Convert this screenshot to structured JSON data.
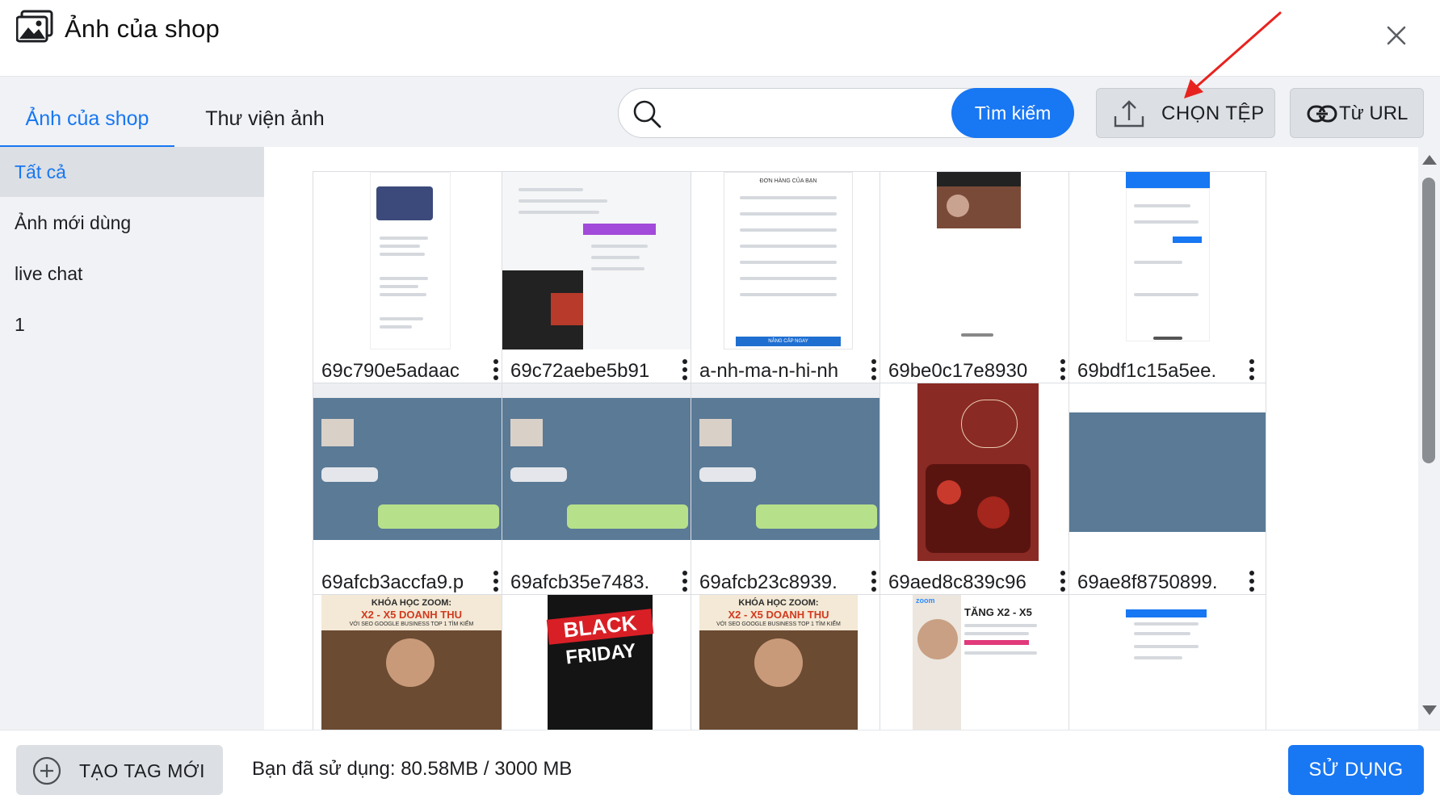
{
  "header": {
    "title": "Ảnh của shop",
    "icon": "image-gallery-icon",
    "close_icon": "close-icon"
  },
  "tabs": [
    {
      "label": "Ảnh của shop",
      "active": true
    },
    {
      "label": "Thư viện ảnh",
      "active": false
    }
  ],
  "search": {
    "placeholder": "",
    "value": "",
    "button_label": "Tìm kiếm",
    "icon": "search-icon"
  },
  "actions": {
    "choose_file_label": "CHỌN TỆP",
    "from_url_label": "Từ URL"
  },
  "sidebar": {
    "items": [
      {
        "label": "Tất cả",
        "active": true
      },
      {
        "label": "Ảnh mới dùng",
        "active": false
      },
      {
        "label": "live chat",
        "active": false
      },
      {
        "label": "1",
        "active": false
      }
    ]
  },
  "images": [
    {
      "name": "69c790e5adaac"
    },
    {
      "name": "69c72aebe5b91"
    },
    {
      "name": "a-nh-ma-n-hi-nh"
    },
    {
      "name": "69be0c17e8930"
    },
    {
      "name": "69bdf1c15a5ee."
    },
    {
      "name": "69afcb3accfa9.p"
    },
    {
      "name": "69afcb35e7483."
    },
    {
      "name": "69afcb23c8939."
    },
    {
      "name": "69aed8c839c96"
    },
    {
      "name": "69ae8f8750899."
    }
  ],
  "thumb_text": {
    "order_title": "ĐƠN HÀNG CỦA BẠN",
    "order_button": "NÂNG CẤP NGAY",
    "zoom_course_1": "KHÓA HỌC ZOOM:",
    "zoom_course_2": "X2 - X5 DOANH THU",
    "zoom_course_3": "VỚI SEO GOOGLE BUSINESS TOP 1 TÌM KIẾM",
    "black": "BLACK",
    "friday": "FRIDAY",
    "zoom_logo": "zoom",
    "tang": "TĂNG X2 - X5"
  },
  "footer": {
    "new_tag_label": "TẠO TAG MỚI",
    "usage_text": "Bạn đã sử dụng: 80.58MB / 3000 MB",
    "use_label": "SỬ DỤNG"
  },
  "colors": {
    "accent": "#1877f2",
    "panel": "#f0f2f5",
    "annotation": "#e8231f"
  }
}
